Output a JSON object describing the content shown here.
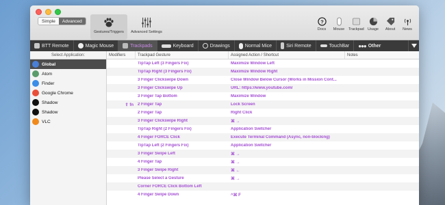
{
  "colors": {
    "accent": "#a44fd2",
    "tab_active_text": "#c98be6"
  },
  "toolbar": {
    "segments": [
      {
        "label": "Simple",
        "active": false
      },
      {
        "label": "Advanced",
        "active": true
      }
    ],
    "gestures_label": "Gestures/Triggers",
    "advanced_settings_label": "Advanced Settings",
    "right_buttons": [
      {
        "label": "Docs",
        "icon": "question-icon"
      },
      {
        "label": "Mouse",
        "icon": "mouse-icon"
      },
      {
        "label": "Trackpad",
        "icon": "trackpad-icon"
      },
      {
        "label": "Usage",
        "icon": "pie-chart-icon"
      },
      {
        "label": "About",
        "icon": "tag-icon"
      },
      {
        "label": "News",
        "icon": "antenna-icon"
      }
    ]
  },
  "tabs": [
    {
      "label": "BTT Remote",
      "active": false
    },
    {
      "label": "Magic Mouse",
      "active": false
    },
    {
      "label": "Trackpads",
      "active": true
    },
    {
      "label": "Keyboard",
      "active": false
    },
    {
      "label": "Drawings",
      "active": false
    },
    {
      "label": "Normal Mice",
      "active": false
    },
    {
      "label": "Siri Remote",
      "active": false
    },
    {
      "label": "TouchBar",
      "active": false
    },
    {
      "label": "Other",
      "active": false
    }
  ],
  "sidebar": {
    "header": "Select Application:",
    "apps": [
      {
        "name": "Global",
        "selected": true,
        "color": "#4a7fd6"
      },
      {
        "name": "Atom",
        "selected": false,
        "color": "#5b9c6c"
      },
      {
        "name": "Finder",
        "selected": false,
        "color": "#3b8de8"
      },
      {
        "name": "Google Chrome",
        "selected": false,
        "color": "#e84f3b"
      },
      {
        "name": "Shadow",
        "selected": false,
        "color": "#111111"
      },
      {
        "name": "Shadow",
        "selected": false,
        "color": "#111111"
      },
      {
        "name": "VLC",
        "selected": false,
        "color": "#f08a1c"
      }
    ]
  },
  "table": {
    "headers": {
      "modifiers": "Modifiers",
      "gesture": "Trackpad Gesture",
      "action": "Assigned Action / Shortcut",
      "notes": "Notes"
    },
    "rows": [
      {
        "mod": "",
        "gesture": "TipTap Left (3 Fingers Fix)",
        "action": "Maximize Window Left"
      },
      {
        "mod": "",
        "gesture": "TipTap Right (3 Fingers Fix)",
        "action": "Maximize Window Right"
      },
      {
        "mod": "",
        "gesture": "3 Finger Clickswipe Down",
        "action": "Close Window Below Cursor (Works in Mission Cont..."
      },
      {
        "mod": "",
        "gesture": "3 Finger Clickswipe Up",
        "action": "URL: https://www.youtube.com/"
      },
      {
        "mod": "",
        "gesture": "3 Finger Tap Bottom",
        "action": "Maximize Window"
      },
      {
        "mod": "⇧ fn",
        "gesture": "2 Finger Tap",
        "action": "Lock Screen"
      },
      {
        "mod": "",
        "gesture": "2 Finger Tap",
        "action": "Right Click"
      },
      {
        "mod": "",
        "gesture": "3 Finger Clickswipe Right",
        "action": "⌘ →"
      },
      {
        "mod": "",
        "gesture": "TipTap Right (2 Fingers Fix)",
        "action": "Application Switcher"
      },
      {
        "mod": "",
        "gesture": "4 Finger FORCE Click",
        "action": "Execute Terminal Command (Async, non-blocking)"
      },
      {
        "mod": "",
        "gesture": "TipTap Left (2 Fingers Fix)",
        "action": "Application Switcher"
      },
      {
        "mod": "",
        "gesture": "3 Finger Swipe Left",
        "action": "⌘ →"
      },
      {
        "mod": "",
        "gesture": "4 Finger Tap",
        "action": "⌘ →"
      },
      {
        "mod": "",
        "gesture": "3 Finger Swipe Right",
        "action": "⌘ ←"
      },
      {
        "mod": "",
        "gesture": "Please Select a Gesture",
        "action": "⌘ →"
      },
      {
        "mod": "",
        "gesture": "Corner FORCE Click Bottom Left",
        "action": ""
      },
      {
        "mod": "",
        "gesture": "4 Finger Swipe Down",
        "action": "^⌘ F"
      }
    ]
  }
}
